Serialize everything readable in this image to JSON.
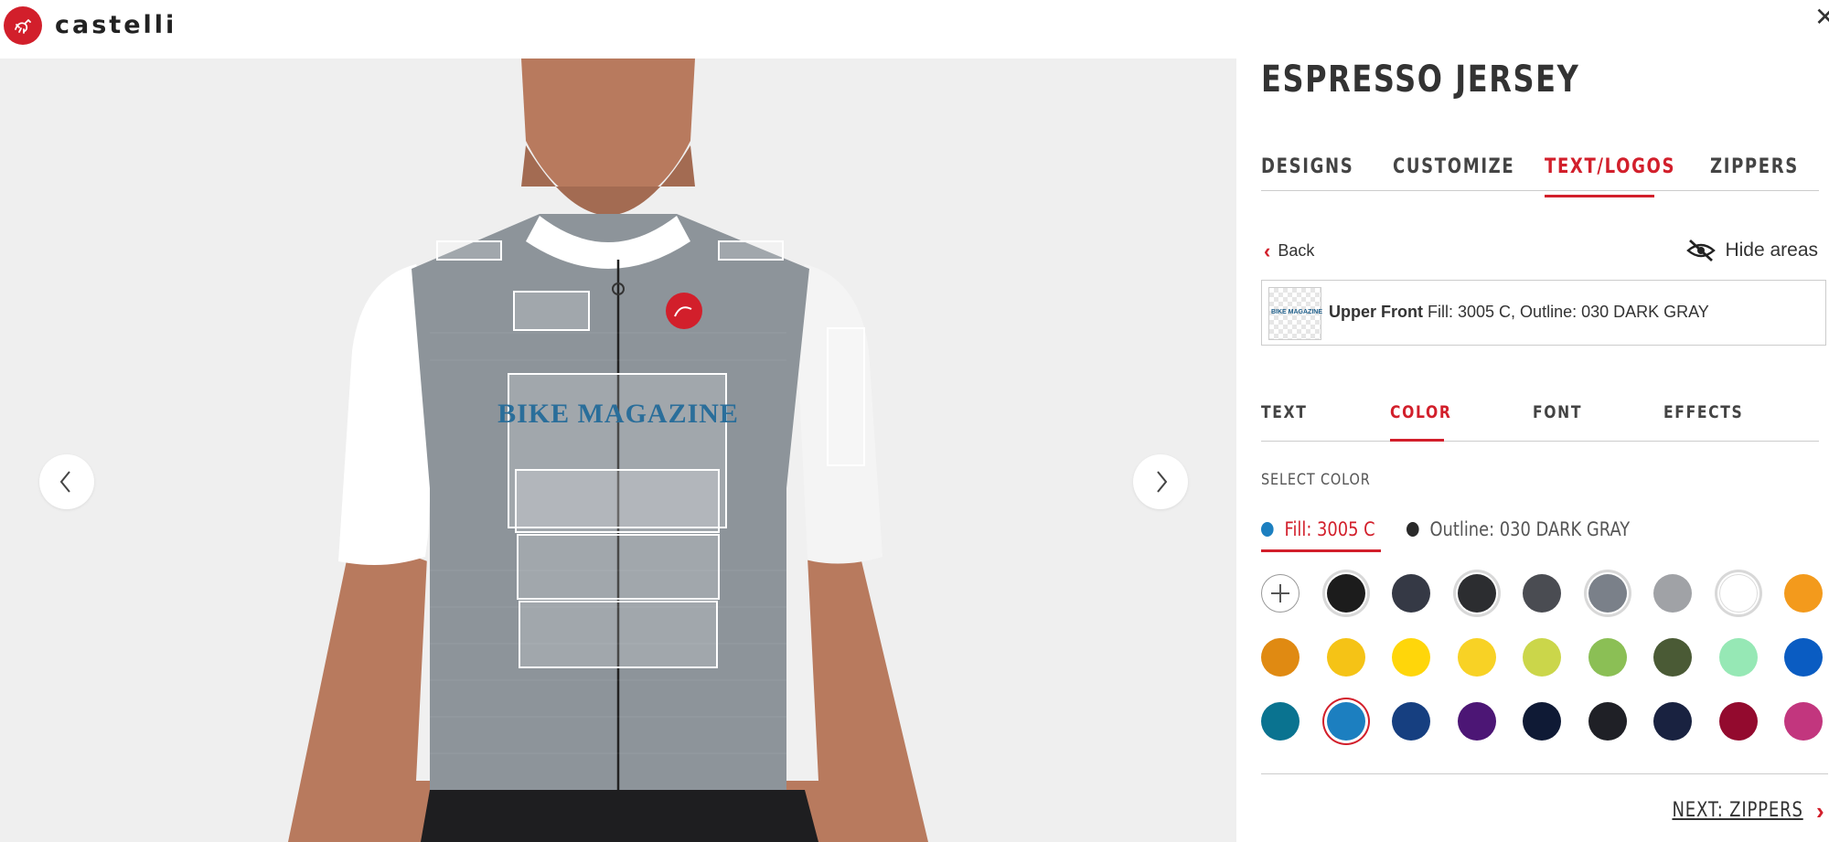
{
  "brand": {
    "name": "castelli",
    "accent": "#d21f2b"
  },
  "product": {
    "title": "ESPRESSO JERSEY"
  },
  "tabs": [
    {
      "label": "DESIGNS",
      "active": false
    },
    {
      "label": "CUSTOMIZE",
      "active": false
    },
    {
      "label": "TEXT/LOGOS",
      "active": true
    },
    {
      "label": "ZIPPERS",
      "active": false
    }
  ],
  "toolbar": {
    "back_label": "Back",
    "hide_label": "Hide areas"
  },
  "area": {
    "thumb_text": "BIKE MAGAZINE",
    "name": "Upper Front",
    "detail": "Fill: 3005 C, Outline: 030 DARK GRAY"
  },
  "subtabs": [
    {
      "label": "TEXT",
      "active": false
    },
    {
      "label": "COLOR",
      "active": true
    },
    {
      "label": "FONT",
      "active": false
    },
    {
      "label": "EFFECTS",
      "active": false
    }
  ],
  "color_panel": {
    "select_label": "SELECT COLOR",
    "fill_label": "Fill: 3005 C",
    "fill_color": "#1c7fc0",
    "outline_label": "Outline: 030 DARK GRAY",
    "outline_color": "#2a2a2a"
  },
  "swatches": [
    [
      "add",
      "#1c1c1c",
      "#353945",
      "#2c2d30",
      "#4a4c52",
      "#7a8089",
      "#a0a2a6",
      "#ffffff",
      "#f39a1c"
    ],
    [
      "#e08a12",
      "#f5c316",
      "#ffd60a",
      "#f8d225",
      "#cbd64a",
      "#8bbf55",
      "#4a5a35",
      "#96e8b5",
      "#0a5cc2"
    ],
    [
      "#0a7390",
      "#1c7fc0",
      "#163f80",
      "#4c1675",
      "#0f1a35",
      "#1f2026",
      "#192240",
      "#930a2e",
      "#c2367e"
    ]
  ],
  "jersey": {
    "text": "BIKE MAGAZINE",
    "body_color": "#8d949a"
  },
  "footer": {
    "next_label": "NEXT: ZIPPERS"
  }
}
